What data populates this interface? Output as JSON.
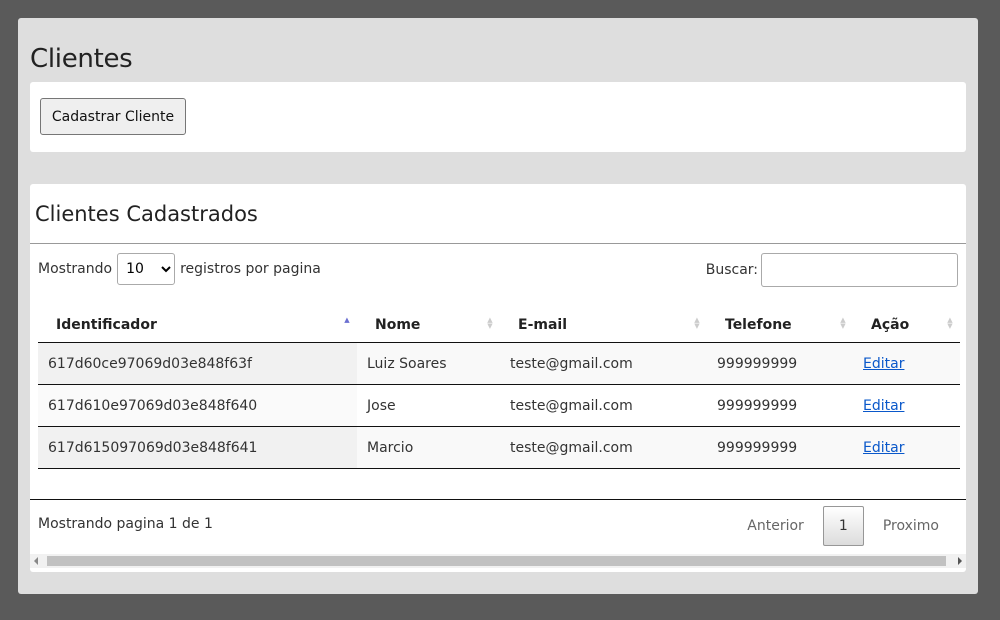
{
  "page": {
    "title": "Clientes"
  },
  "actions": {
    "add_client_label": "Cadastrar Cliente"
  },
  "table_card": {
    "title": "Clientes Cadastrados",
    "length": {
      "prefix": "Mostrando",
      "selected": "10",
      "suffix": "registros por pagina"
    },
    "search": {
      "label": "Buscar:",
      "value": ""
    },
    "columns": [
      "Identificador",
      "Nome",
      "E-mail",
      "Telefone",
      "Ação"
    ],
    "sorted_column": "Identificador",
    "sort_direction": "ascending",
    "rows": [
      {
        "id": "617d60ce97069d03e848f63f",
        "nome": "Luiz Soares",
        "email": "teste@gmail.com",
        "telefone": "999999999",
        "acao": "Editar"
      },
      {
        "id": "617d610e97069d03e848f640",
        "nome": "Jose",
        "email": "teste@gmail.com",
        "telefone": "999999999",
        "acao": "Editar"
      },
      {
        "id": "617d615097069d03e848f641",
        "nome": "Marcio",
        "email": "teste@gmail.com",
        "telefone": "999999999",
        "acao": "Editar"
      }
    ],
    "info": "Mostrando pagina 1 de 1",
    "pagination": {
      "previous": "Anterior",
      "current": "1",
      "next": "Proximo"
    }
  },
  "colors": {
    "sort_active": "#6b6fd1",
    "link": "#0a58ca",
    "page_bg": "#5a5a5a",
    "panel_bg": "#dedede"
  }
}
